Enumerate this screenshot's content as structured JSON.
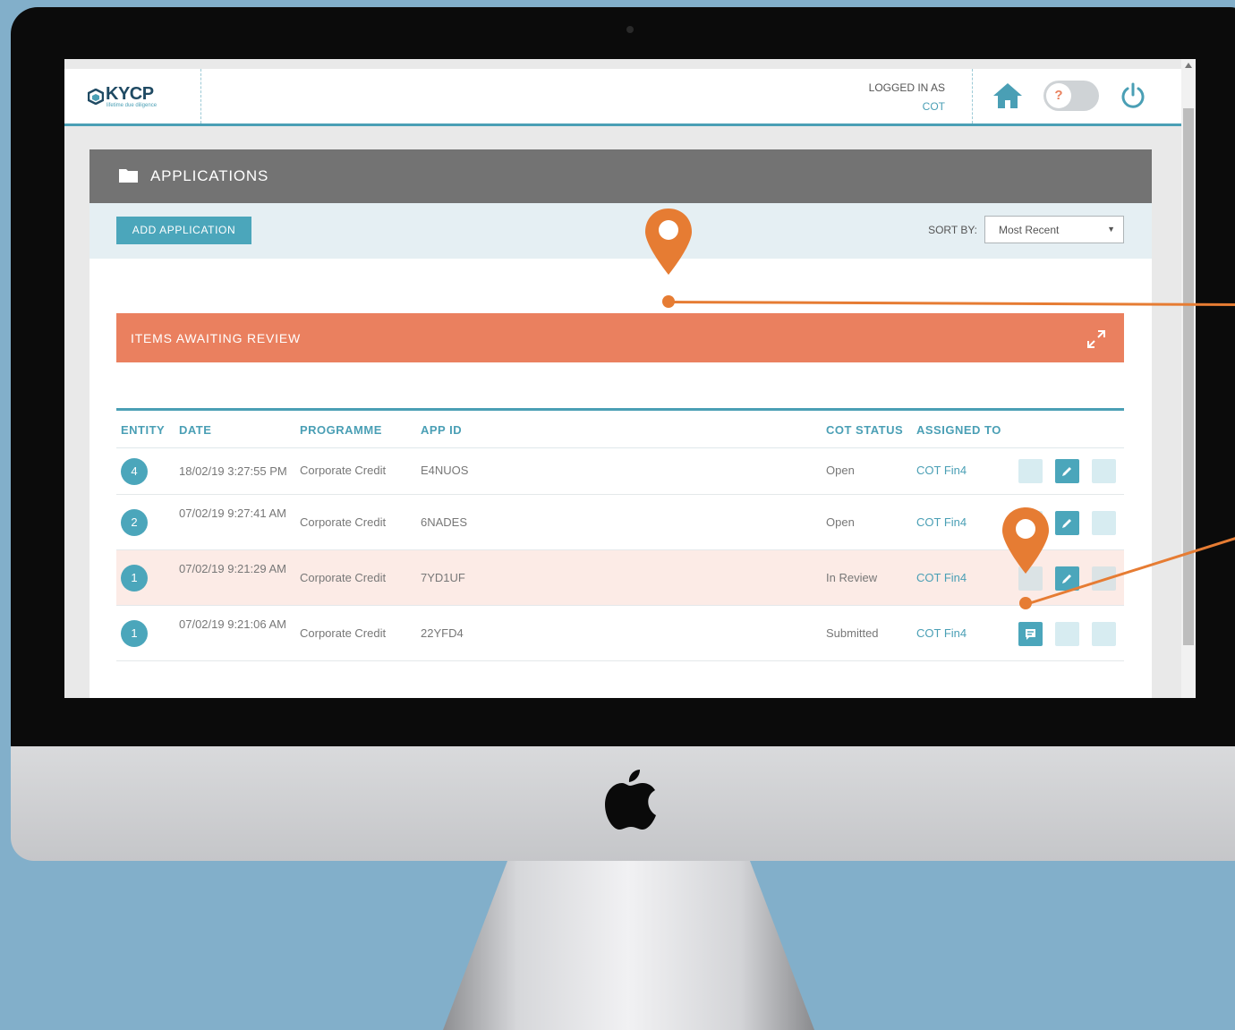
{
  "header": {
    "logo_text": "KYCP",
    "logo_tagline": "lifetime due diligence",
    "logged_in_label": "LOGGED IN AS",
    "logged_in_user": "COT",
    "help_label": "?"
  },
  "panel": {
    "title": "APPLICATIONS",
    "add_button": "ADD APPLICATION",
    "sort_label": "SORT BY:",
    "sort_value": "Most Recent"
  },
  "review": {
    "title": "ITEMS AWAITING REVIEW"
  },
  "table": {
    "columns": [
      "ENTITY",
      "DATE",
      "PROGRAMME",
      "APP ID",
      "COT STATUS",
      "ASSIGNED TO"
    ],
    "rows": [
      {
        "entity": "4",
        "date": "18/02/19 3:27:55 PM",
        "programme": "Corporate Credit",
        "app_id": "E4NUOS",
        "status": "Open",
        "assigned": "COT Fin4"
      },
      {
        "entity": "2",
        "date": "07/02/19 9:27:41 AM",
        "programme": "Corporate Credit",
        "app_id": "6NADES",
        "status": "Open",
        "assigned": "COT Fin4"
      },
      {
        "entity": "1",
        "date": "07/02/19 9:21:29 AM",
        "programme": "Corporate Credit",
        "app_id": "7YD1UF",
        "status": "In Review",
        "assigned": "COT Fin4"
      },
      {
        "entity": "1",
        "date": "07/02/19 9:21:06 AM",
        "programme": "Corporate Credit",
        "app_id": "22YFD4",
        "status": "Submitted",
        "assigned": "COT Fin4"
      }
    ]
  },
  "icons": {
    "home": "home-icon",
    "power": "power-icon",
    "folder": "folder-icon",
    "expand": "expand-icon",
    "comment": "comment-icon",
    "edit": "pencil-icon",
    "delete": "delete-icon",
    "marker": "map-pin-icon",
    "brand": "apple-logo"
  },
  "colors": {
    "accent": "#4ba6bb",
    "banner": "#ea805f",
    "header": "#737373",
    "marker": "#e67c33",
    "background": "#82afca"
  }
}
